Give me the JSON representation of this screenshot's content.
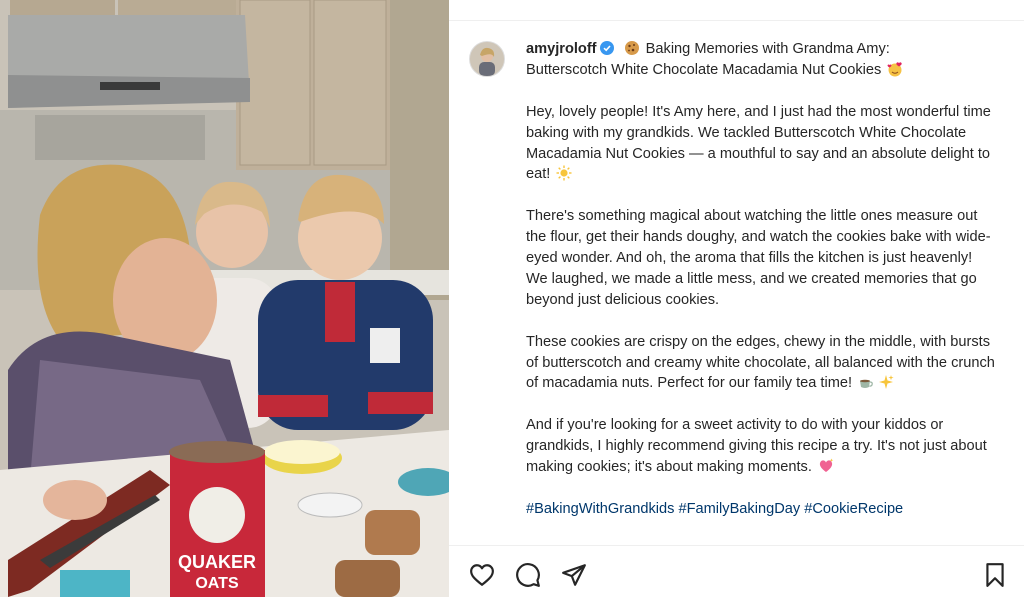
{
  "post": {
    "username": "amyjroloff",
    "title_line1": "Baking Memories with Grandma Amy:",
    "title_line2": "Butterscotch White Chocolate Macadamia Nut Cookies",
    "paragraph1": "Hey, lovely people! It's Amy here, and I just had the most wonderful time baking with my grandkids. We tackled Butterscotch White Chocolate Macadamia Nut Cookies — a mouthful to say and an absolute delight to eat!",
    "paragraph2": "There's something magical about watching the little ones measure out the flour, get their hands doughy, and watch the cookies bake with wide-eyed wonder. And oh, the aroma that fills the kitchen is just heavenly! We laughed, we made a little mess, and we created memories that go beyond just delicious cookies.",
    "paragraph3": "These cookies are crispy on the edges, chewy in the middle, with bursts of butterscotch and creamy white chocolate, all balanced with the crunch of macadamia nuts. Perfect for our family tea time!",
    "paragraph4": "And if you're looking for a sweet activity to do with your kiddos or grandkids, I highly recommend giving this recipe a try. It's not just about making cookies; it's about making moments.",
    "hashtags": "#BakingWithGrandkids #FamilyBakingDay #CookieRecipe"
  },
  "media": {
    "oats_label_top": "QUAKER",
    "oats_label_bottom": "OATS"
  },
  "icons": {
    "like": "heart-icon",
    "comment": "comment-icon",
    "share": "paper-plane-icon",
    "save": "bookmark-icon",
    "verified": "verified-badge-icon",
    "cookie": "cookie-emoji",
    "heart_face": "smiling-face-with-hearts-emoji",
    "sun": "sun-emoji",
    "tea": "teacup-emoji",
    "sparkles": "sparkles-emoji",
    "heart": "sparkling-heart-emoji"
  },
  "colors": {
    "verified": "#3897f0",
    "text": "#262626",
    "hashtag": "#00376b"
  }
}
